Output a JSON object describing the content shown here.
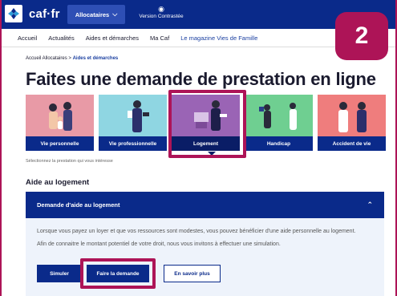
{
  "header": {
    "brand": "caf·fr",
    "allocataires_label": "Allocataires",
    "contrast_label": "Version Contrastée"
  },
  "nav": {
    "items": [
      "Accueil",
      "Actualités",
      "Aides et démarches",
      "Ma Caf",
      "Le magazine Vies de Famille"
    ]
  },
  "step_badge": "2",
  "breadcrumb": {
    "root": "Accueil Allocataires",
    "separator": ">",
    "current": "Aides et démarches"
  },
  "page_title": "Faites une demande de prestation en ligne",
  "tiles": [
    {
      "label": "Vie personnelle",
      "bg": "#e89aa6"
    },
    {
      "label": "Vie professionnelle",
      "bg": "#8fd6e2"
    },
    {
      "label": "Logement",
      "bg": "#9a64b5",
      "selected": true
    },
    {
      "label": "Handicap",
      "bg": "#6fcf91"
    },
    {
      "label": "Accident de vie",
      "bg": "#ef7d7d"
    }
  ],
  "select_hint": "Sélectionnez la prestation qui vous intéresse",
  "section_title": "Aide au logement",
  "accordion": {
    "title": "Demande d'aide au logement",
    "paragraph_1": "Lorsque vous payez un loyer et que vos ressources sont modestes, vous pouvez bénéficier d'une aide personnelle au logement.",
    "paragraph_2": "Afin de connaitre le montant potentiel de votre droit, nous vous invitons à effectuer une simulation.",
    "buttons": {
      "simulate": "Simuler",
      "apply": "Faire la demande",
      "more": "En savoir plus"
    }
  },
  "colors": {
    "primary": "#0a2a8a",
    "highlight": "#ad1457",
    "panel": "#eef3fb"
  }
}
